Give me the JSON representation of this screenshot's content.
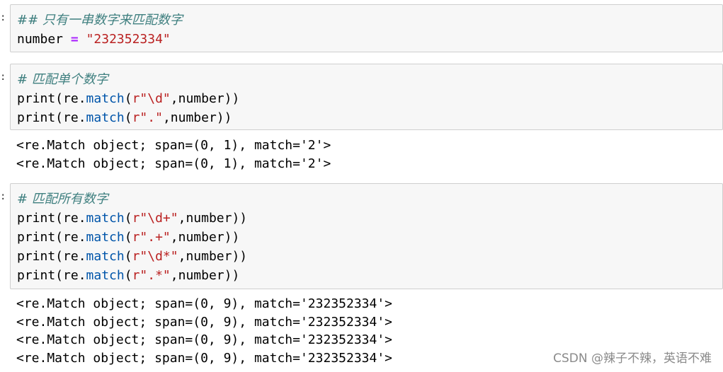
{
  "gutter_mark": ":",
  "cells": [
    {
      "input": {
        "comment": "## 只有一串数字来匹配数字",
        "assign_name": "number",
        "assign_op": "=",
        "assign_value": "\"232352334\""
      }
    },
    {
      "input": {
        "comment": "# 匹配单个数字",
        "lines": [
          {
            "prefix": "print(re.",
            "func": "match",
            "open": "(",
            "raw": "r\"\\d\"",
            "rest": ",number))"
          },
          {
            "prefix": "print(re.",
            "func": "match",
            "open": "(",
            "raw": "r\".\"",
            "rest": ",number))"
          }
        ]
      },
      "output": [
        "<re.Match object; span=(0, 1), match='2'>",
        "<re.Match object; span=(0, 1), match='2'>"
      ]
    },
    {
      "input": {
        "comment": "# 匹配所有数字",
        "lines": [
          {
            "prefix": "print(re.",
            "func": "match",
            "open": "(",
            "raw": "r\"\\d+\"",
            "rest": ",number))"
          },
          {
            "prefix": "print(re.",
            "func": "match",
            "open": "(",
            "raw": "r\".+\"",
            "rest": ",number))"
          },
          {
            "prefix": "print(re.",
            "func": "match",
            "open": "(",
            "raw": "r\"\\d*\"",
            "rest": ",number))"
          },
          {
            "prefix": "print(re.",
            "func": "match",
            "open": "(",
            "raw": "r\".*\"",
            "rest": ",number))"
          }
        ]
      },
      "output": [
        "<re.Match object; span=(0, 9), match='232352334'>",
        "<re.Match object; span=(0, 9), match='232352334'>",
        "<re.Match object; span=(0, 9), match='232352334'>",
        "<re.Match object; span=(0, 9), match='232352334'>"
      ]
    }
  ],
  "watermark": "CSDN @辣子不辣，英语不难"
}
